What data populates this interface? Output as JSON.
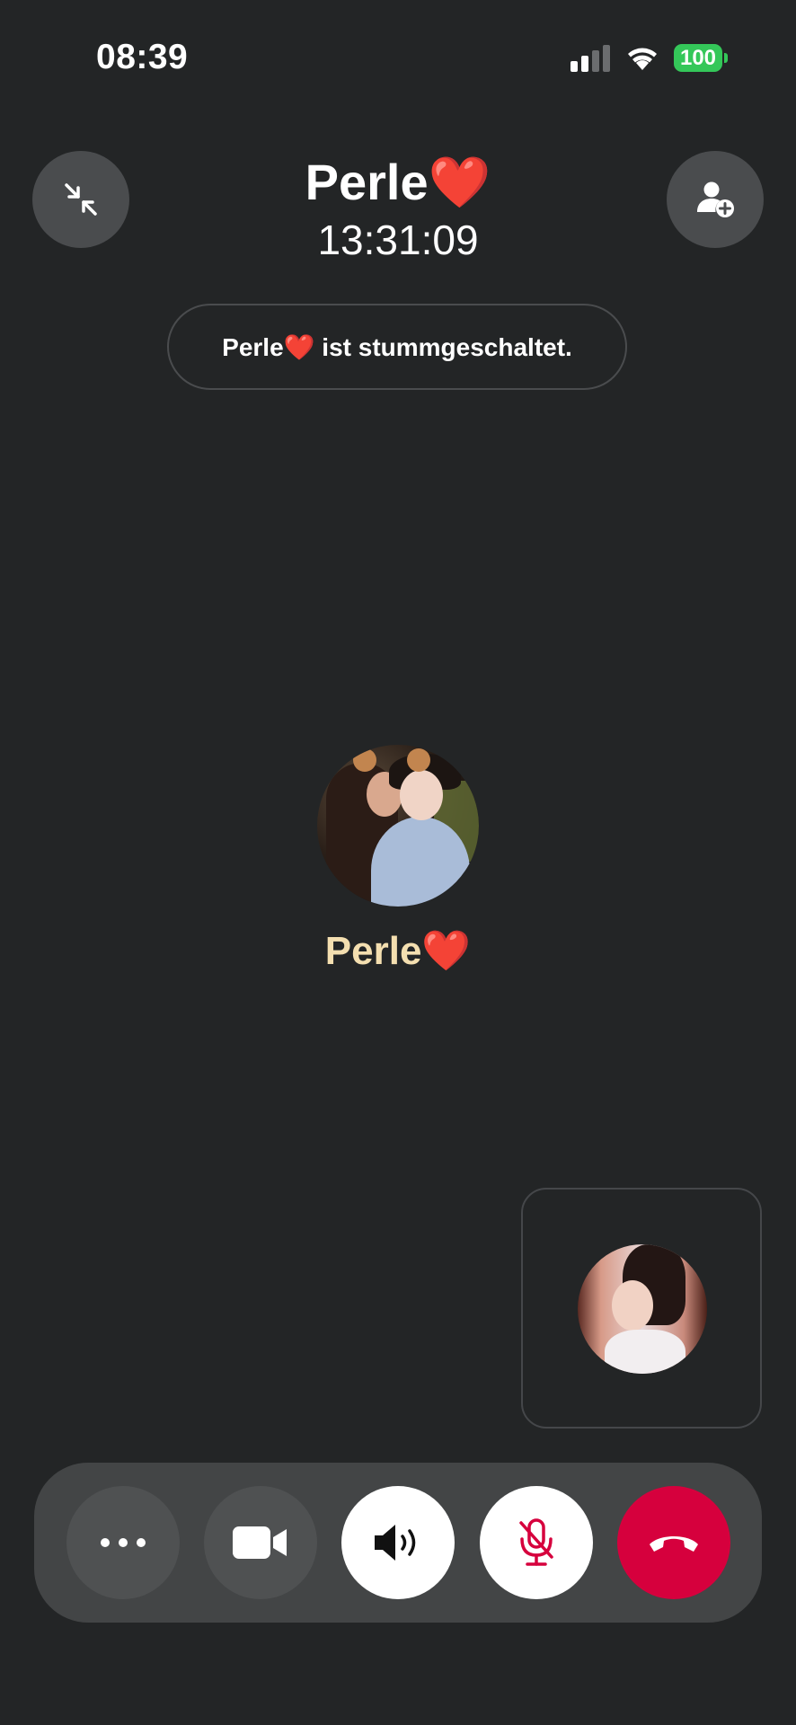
{
  "status_bar": {
    "time": "08:39",
    "battery_percent": "100",
    "battery_color": "#34c759",
    "icons": [
      "cellular-signal-icon",
      "wifi-icon",
      "battery-icon"
    ]
  },
  "header": {
    "contact_name": "Perle❤️",
    "call_duration": "13:31:09",
    "minimize_icon": "minimize-arrows-icon",
    "add_participant_icon": "add-person-icon"
  },
  "banner": {
    "muted_text": "Perle❤️ ist stummgeschaltet."
  },
  "main": {
    "participant_name": "Perle❤️",
    "name_color": "#f4dfb0"
  },
  "controls": {
    "items": [
      {
        "name": "more-options",
        "icon": "more-dots-icon"
      },
      {
        "name": "video",
        "icon": "video-camera-icon"
      },
      {
        "name": "speaker",
        "icon": "speaker-icon"
      },
      {
        "name": "microphone",
        "icon": "microphone-muted-icon"
      },
      {
        "name": "end-call",
        "icon": "phone-hangup-icon"
      }
    ],
    "end_call_color": "#d6003d",
    "mic_muted_color": "#d6003d"
  }
}
